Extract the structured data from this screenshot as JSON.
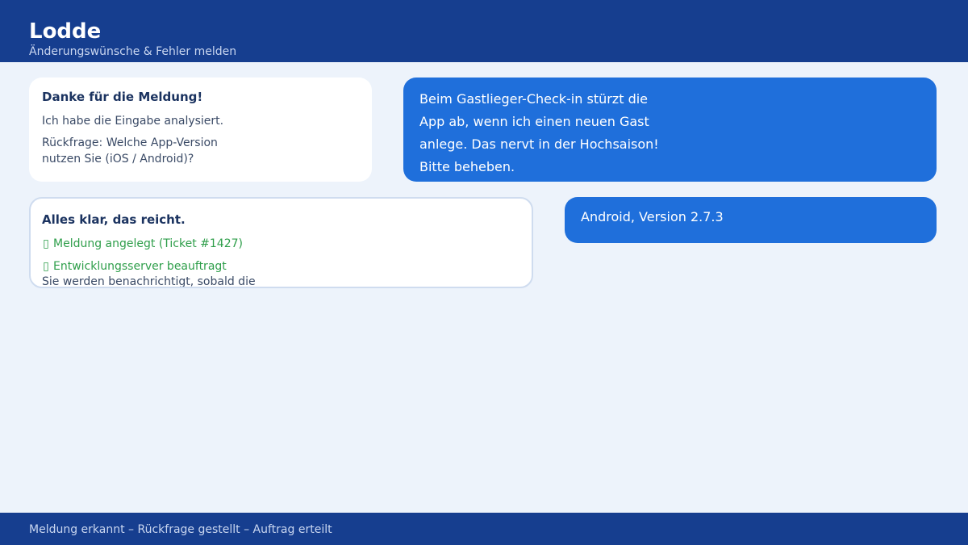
{
  "header": {
    "title": "Lodde",
    "subtitle": "Änderungswünsche & Fehler melden"
  },
  "messages": {
    "bot_1": {
      "title": "Danke für die Meldung!",
      "line_1": "Ich habe die Eingabe analysiert.",
      "line_2": "Rückfrage: Welche App-Version nutzen Sie (iOS / Android)?"
    },
    "user_1": {
      "text": "Beim Gastlieger-Check-in stürzt die App ab, wenn ich einen neuen Gast anlege. Das nervt in der Hochsaison! Bitte beheben."
    },
    "bot_2": {
      "title": "Alles klar, das reicht.",
      "status_1": "Meldung angelegt (Ticket #1427)",
      "status_2": "Entwicklungsserver beauftragt",
      "line_cut": "Sie werden benachrichtigt, sobald die"
    },
    "user_2": {
      "text": "Android, Version 2.7.3"
    }
  },
  "footer": {
    "status": "Meldung erkannt – Rückfrage gestellt – Auftrag erteilt"
  },
  "colors": {
    "header_bg": "#163e8f",
    "page_bg": "#edf3fb",
    "user_bubble": "#1f6fdb",
    "success": "#2e9e4a"
  },
  "icons": {
    "status_check": "check-icon"
  }
}
